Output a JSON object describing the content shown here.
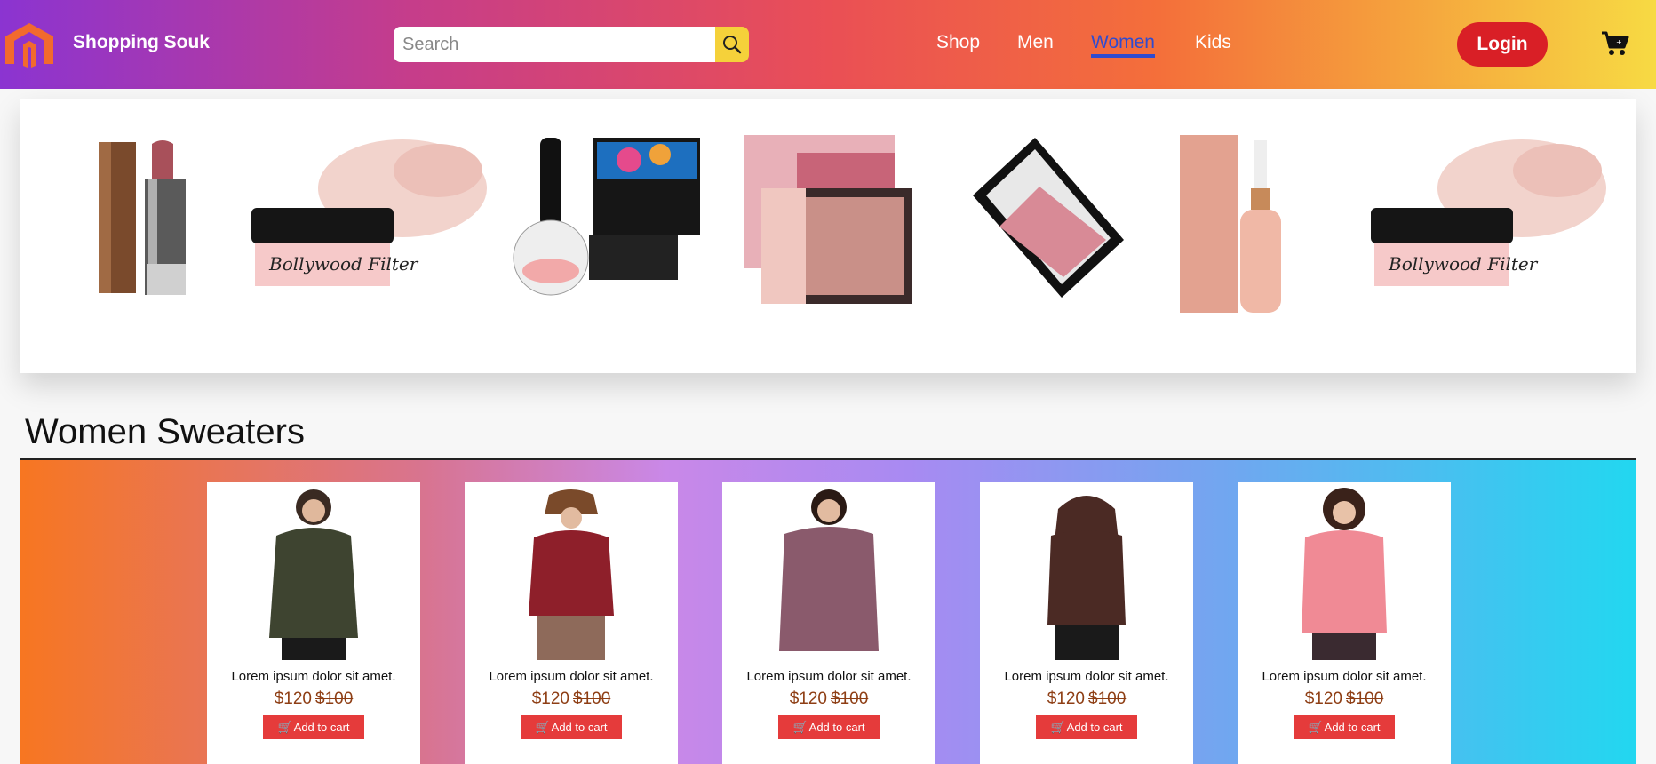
{
  "header": {
    "brand": "Shopping Souk",
    "search_placeholder": "Search",
    "nav": [
      "Shop",
      "Men",
      "Women",
      "Kids"
    ],
    "active_nav": "Women",
    "login_label": "Login",
    "colors": {
      "accent": "#d91f26",
      "active_nav": "#2f4bd0",
      "search_button": "#f5d13a"
    }
  },
  "carousel": {
    "products": [
      "lipstick",
      "face-powder",
      "makeup-brush-cleaner",
      "eyeshadow-palette-nude",
      "eyeshadow-palette-dark",
      "face-serum",
      "face-powder"
    ]
  },
  "section": {
    "title": "Women Sweaters",
    "cards": [
      {
        "desc": "Lorem ipsum dolor sit amet.",
        "price": "$120",
        "old_price": "$100",
        "button": "Add to cart",
        "jacket_color": "#3e4430"
      },
      {
        "desc": "Lorem ipsum dolor sit amet.",
        "price": "$120",
        "old_price": "$100",
        "button": "Add to cart",
        "jacket_color": "#8e1f2a"
      },
      {
        "desc": "Lorem ipsum dolor sit amet.",
        "price": "$120",
        "old_price": "$100",
        "button": "Add to cart",
        "jacket_color": "#8a5a6c"
      },
      {
        "desc": "Lorem ipsum dolor sit amet.",
        "price": "$120",
        "old_price": "$100",
        "button": "Add to cart",
        "jacket_color": "#4b2a24"
      },
      {
        "desc": "Lorem ipsum dolor sit amet.",
        "price": "$120",
        "old_price": "$100",
        "button": "Add to cart",
        "jacket_color": "#f08a95"
      }
    ]
  }
}
